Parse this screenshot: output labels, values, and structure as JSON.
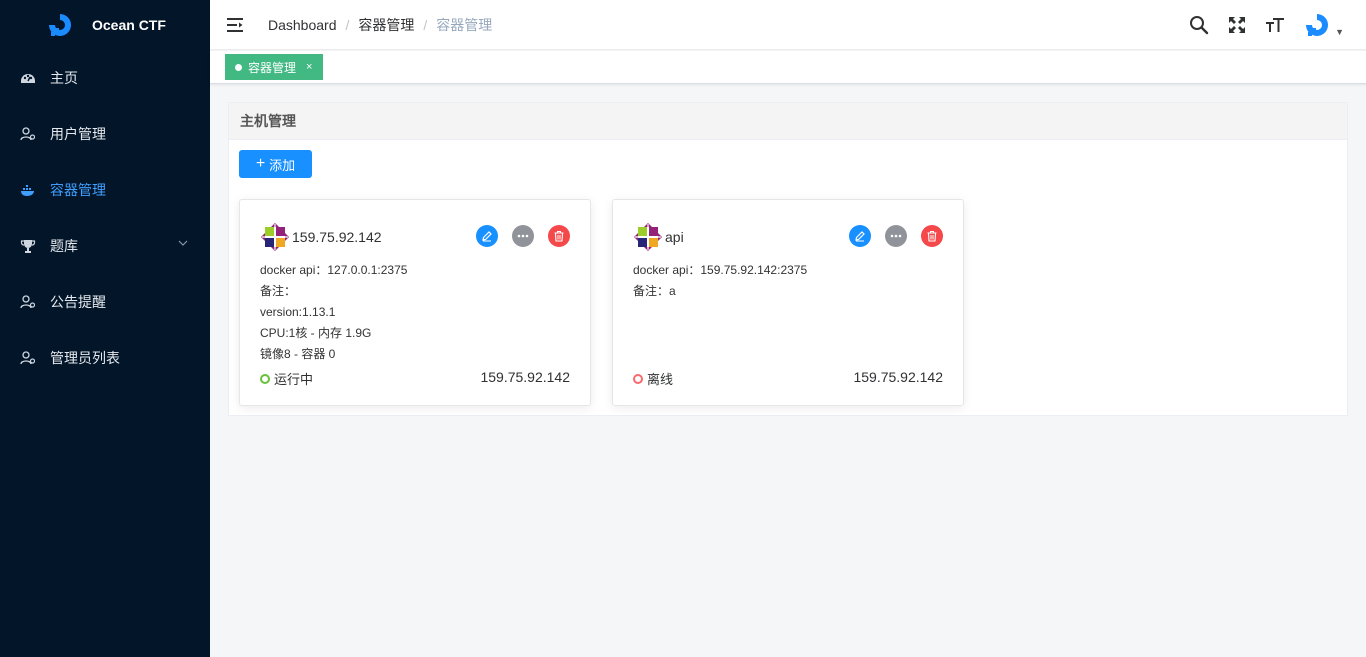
{
  "app": {
    "title": "Ocean CTF"
  },
  "sidebar": {
    "items": [
      {
        "label": "主页",
        "icon": "dashboard-icon",
        "active": false
      },
      {
        "label": "用户管理",
        "icon": "user-icon",
        "active": false
      },
      {
        "label": "容器管理",
        "icon": "docker-icon",
        "active": true
      },
      {
        "label": "题库",
        "icon": "trophy-icon",
        "active": false,
        "expandable": true
      },
      {
        "label": "公告提醒",
        "icon": "user-icon",
        "active": false
      },
      {
        "label": "管理员列表",
        "icon": "user-icon",
        "active": false
      }
    ]
  },
  "header": {
    "breadcrumb": [
      "Dashboard",
      "容器管理",
      "容器管理"
    ],
    "icons": [
      "search-icon",
      "fullscreen-icon",
      "font-size-icon",
      "avatar"
    ]
  },
  "tags": [
    {
      "label": "容器管理",
      "close": "×",
      "active": true
    }
  ],
  "panel": {
    "title": "主机管理",
    "add_button": "添加",
    "add_plus": "+"
  },
  "hosts": [
    {
      "name": "159.75.92.142",
      "lines": [
        "docker api：127.0.0.1:2375",
        "备注：",
        "version:1.13.1",
        "CPU:1核 - 内存 1.9G",
        "镜像8 - 容器 0"
      ],
      "status": "运行中",
      "status_color": "#67c23a",
      "ip": "159.75.92.142"
    },
    {
      "name": "api",
      "lines": [
        "docker api：159.75.92.142:2375",
        "备注：a"
      ],
      "status": "离线",
      "status_color": "#f56c6c",
      "ip": "159.75.92.142"
    }
  ],
  "colors": {
    "sidebar_bg": "#021529",
    "accent": "#409eff",
    "tag_bg": "#42b983",
    "primary_btn": "#1890ff",
    "danger": "#f5484a"
  }
}
